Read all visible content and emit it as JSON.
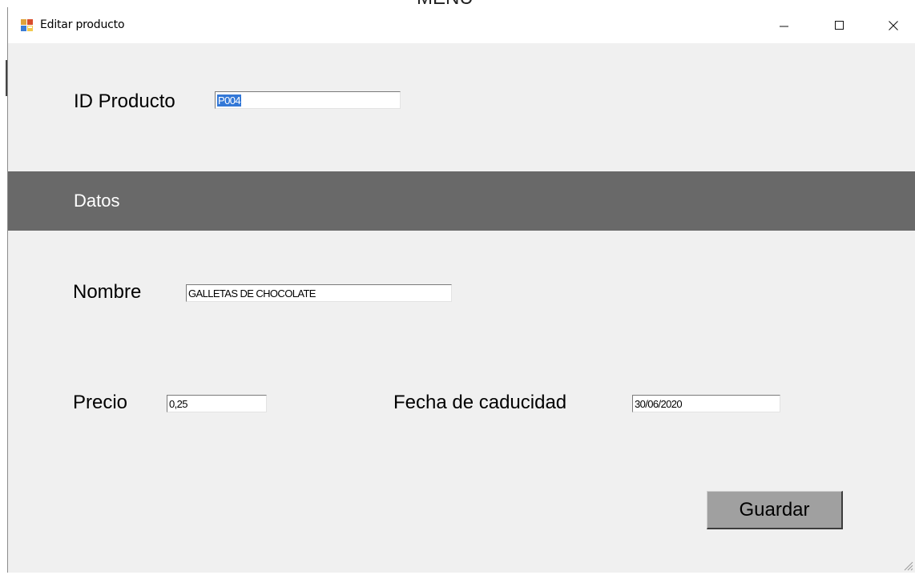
{
  "window": {
    "title": "Editar producto",
    "background_text": "MENU"
  },
  "titlebar_buttons": {
    "minimize_icon": "minimize-icon",
    "maximize_icon": "maximize-icon",
    "close_icon": "close-icon"
  },
  "id_section": {
    "label": "ID Producto",
    "value": "P004"
  },
  "data_section": {
    "title": "Datos",
    "band_color": "#696969"
  },
  "fields": {
    "nombre": {
      "label": "Nombre",
      "value": "GALLETAS DE CHOCOLATE"
    },
    "precio": {
      "label": "Precio",
      "value": "0,25"
    },
    "fecha": {
      "label": "Fecha de caducidad",
      "value": "30/06/2020"
    }
  },
  "actions": {
    "save_label": "Guardar"
  },
  "colors": {
    "selection": "#3378d7",
    "form_bg": "#f0f0f0"
  }
}
